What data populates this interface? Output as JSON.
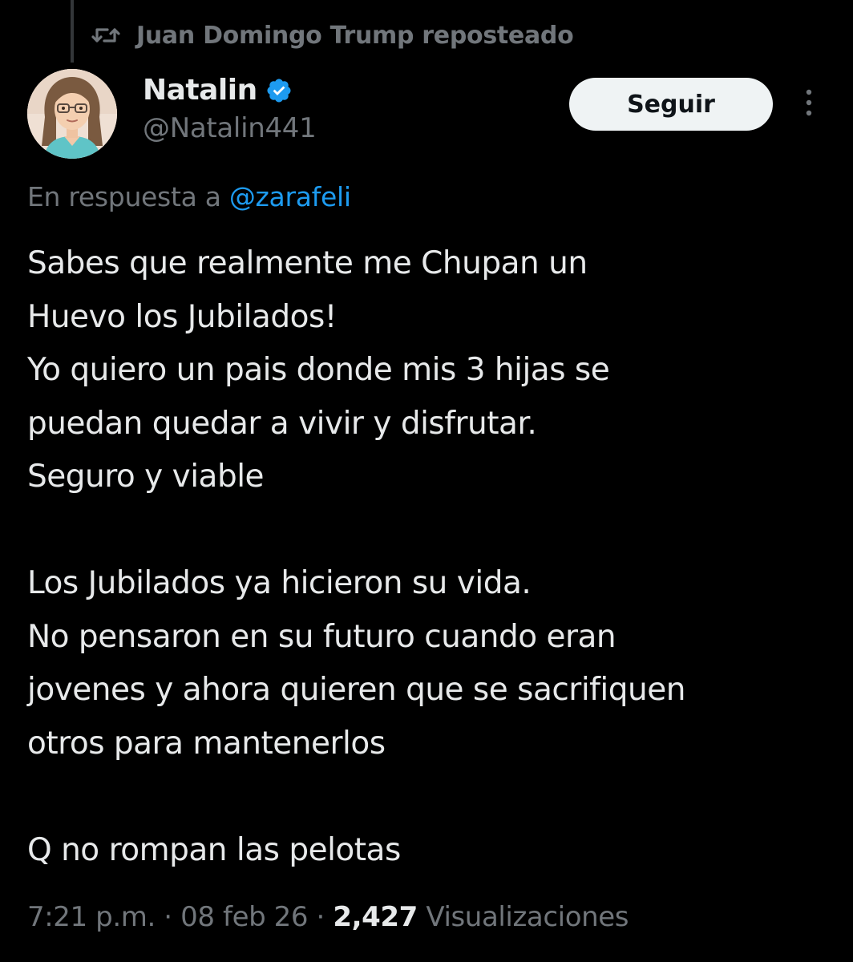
{
  "repost": {
    "text": "Juan Domingo Trump reposteado",
    "icon": "repost-icon"
  },
  "author": {
    "display_name": "Natalin",
    "handle": "@Natalin441",
    "verified_icon": "verified-badge-icon",
    "verified_color": "#1d9bf0",
    "avatar_icon": "cartoon-avatar"
  },
  "follow_button": {
    "label": "Seguir"
  },
  "more_options": {
    "icon": "more-vertical-icon"
  },
  "reply_context": {
    "prefix": "En respuesta a ",
    "mention": "@zarafeli"
  },
  "tweet": {
    "lines": [
      "Sabes que realmente me Chupan un",
      "Huevo los Jubilados!",
      "Yo quiero un pais donde mis 3 hijas se",
      "puedan quedar a vivir y disfrutar.",
      "Seguro y viable",
      "",
      "Los Jubilados ya hicieron su vida.",
      "No pensaron en su futuro cuando eran",
      "jovenes y ahora quieren que se sacrifiquen",
      "otros para mantenerlos",
      "",
      "Q no rompan las pelotas"
    ]
  },
  "meta": {
    "time": "7:21 p.m.",
    "separator_1": " · ",
    "date": "08 feb 26",
    "separator_2": " · ",
    "views_count": "2,427",
    "views_label": " Visualizaciones"
  },
  "colors": {
    "background": "#000000",
    "primary_text": "#e7e9ea",
    "secondary_text": "#71767b",
    "link": "#1d9bf0",
    "button_bg": "#eff3f4",
    "button_text": "#0f1419"
  }
}
